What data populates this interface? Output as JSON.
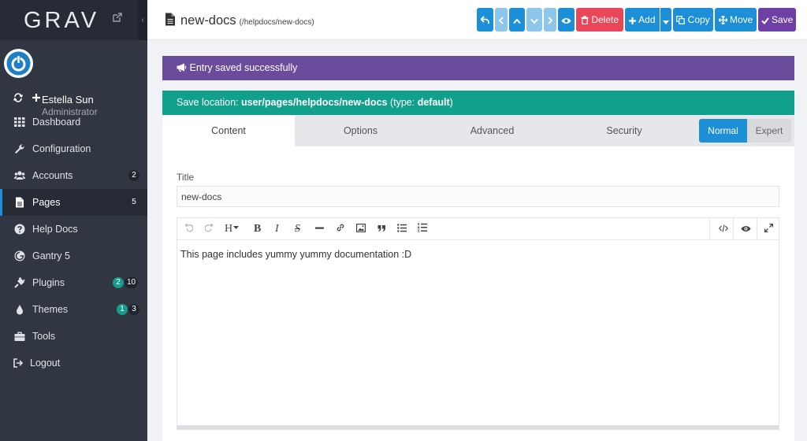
{
  "app": {
    "logo": "GRAV"
  },
  "user": {
    "name": "Estella Sun",
    "role": "Administrator"
  },
  "sidebar": {
    "items": [
      {
        "label": "Dashboard",
        "icon": "dashboard-grid-icon"
      },
      {
        "label": "Configuration",
        "icon": "wrench-icon"
      },
      {
        "label": "Accounts",
        "icon": "users-icon",
        "badge": "2"
      },
      {
        "label": "Pages",
        "icon": "file-icon",
        "badge": "5",
        "active": true
      },
      {
        "label": "Help Docs",
        "icon": "question-circle-icon"
      },
      {
        "label": "Gantry 5",
        "icon": "gantry-icon"
      },
      {
        "label": "Plugins",
        "icon": "plug-icon",
        "badge_updates": "2",
        "badge": "10"
      },
      {
        "label": "Themes",
        "icon": "tint-icon",
        "badge_updates": "1",
        "badge": "3"
      },
      {
        "label": "Tools",
        "icon": "briefcase-icon"
      },
      {
        "label": "Logout",
        "icon": "sign-out-icon"
      }
    ]
  },
  "header": {
    "title": "new-docs",
    "route": "(/helpdocs/new-docs)",
    "buttons": {
      "delete": "Delete",
      "add": "Add",
      "copy": "Copy",
      "move": "Move",
      "save": "Save"
    }
  },
  "alert": {
    "message": "Entry saved successfully"
  },
  "save_location": {
    "prefix": "Save location: ",
    "path": "user/pages/helpdocs/new-docs",
    "type_prefix": " (type: ",
    "type": "default",
    "type_suffix": ")"
  },
  "tabs": [
    "Content",
    "Options",
    "Advanced",
    "Security"
  ],
  "modes": {
    "normal": "Normal",
    "expert": "Expert"
  },
  "form": {
    "title_label": "Title",
    "title_value": "new-docs",
    "content": "This page includes yummy yummy documentation :D"
  },
  "colors": {
    "accent": "#1c8fd6",
    "alert": "#6a4b9c",
    "save_location": "#11a08c",
    "danger": "#e9465a",
    "save": "#6e3fa4"
  }
}
